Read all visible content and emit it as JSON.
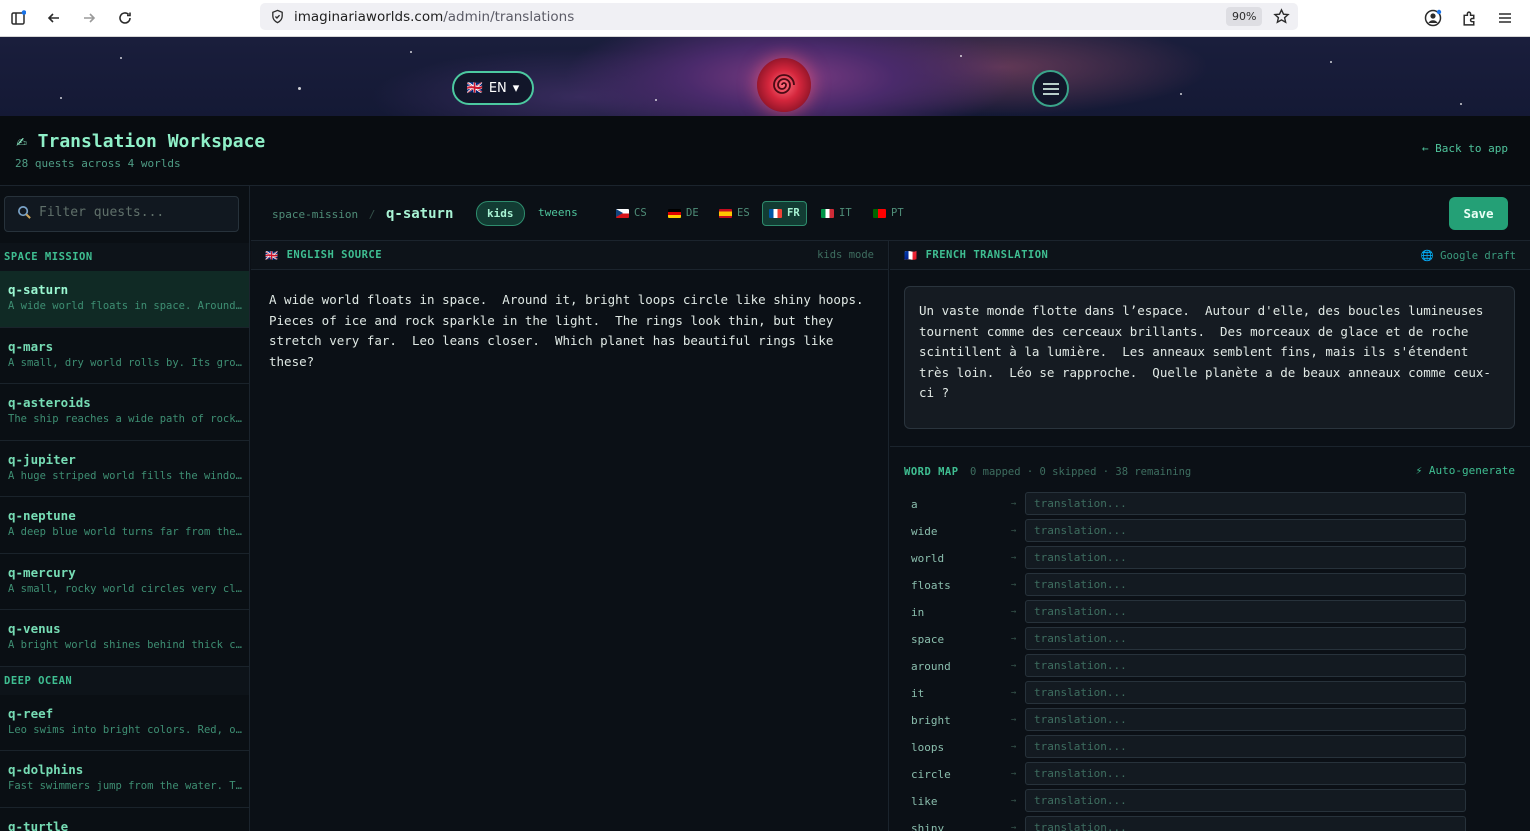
{
  "browser": {
    "url_host": "imaginariaworlds.com",
    "url_path": "/admin/translations",
    "zoom": "90%"
  },
  "banner": {
    "lang_flag": "🇬🇧",
    "lang_code": "EN",
    "lang_caret": "▾"
  },
  "header": {
    "title": "✍ Translation Workspace",
    "subtitle": "28 quests across 4 worlds",
    "back_link": "← Back to app"
  },
  "sidebar": {
    "filter_placeholder": "Filter quests...",
    "sections": [
      {
        "title": "SPACE MISSION",
        "quests": [
          {
            "name": "q-saturn",
            "desc": "A wide world floats in space. Around it, bright loops circle like shiny hoops."
          },
          {
            "name": "q-mars",
            "desc": "A small, dry world rolls by. Its ground is red and dusty."
          },
          {
            "name": "q-asteroids",
            "desc": "The ship reaches a wide path of rocks floating in space."
          },
          {
            "name": "q-jupiter",
            "desc": "A huge striped world fills the window. Storms swirl across it."
          },
          {
            "name": "q-neptune",
            "desc": "A deep blue world turns far from the sun."
          },
          {
            "name": "q-mercury",
            "desc": "A small, rocky world circles very close to the sun."
          },
          {
            "name": "q-venus",
            "desc": "A bright world shines behind thick clouds."
          }
        ]
      },
      {
        "title": "DEEP OCEAN",
        "quests": [
          {
            "name": "q-reef",
            "desc": "Leo swims into bright colors. Red, orange and purple coral grow everywhere."
          },
          {
            "name": "q-dolphins",
            "desc": "Fast swimmers jump from the water. They click and whistle."
          },
          {
            "name": "q-turtle",
            "desc": ""
          }
        ]
      }
    ]
  },
  "topbar": {
    "crumb_world": "space-mission",
    "crumb_sep": "/",
    "crumb_quest": "q-saturn",
    "modes": [
      "kids",
      "tweens"
    ],
    "languages": [
      {
        "code": "CS",
        "flag": "cz"
      },
      {
        "code": "DE",
        "flag": "de"
      },
      {
        "code": "ES",
        "flag": "es"
      },
      {
        "code": "FR",
        "flag": "fr"
      },
      {
        "code": "IT",
        "flag": "it"
      },
      {
        "code": "PT",
        "flag": "pt"
      }
    ],
    "save_label": "Save"
  },
  "source": {
    "flag": "🇬🇧",
    "title": "ENGLISH SOURCE",
    "mode_note": "kids mode",
    "text": "A wide world floats in space.  Around it, bright loops circle like shiny hoops.\nPieces of ice and rock sparkle in the light.  The rings look thin, but they\nstretch very far.  Leo leans closer.  Which planet has beautiful rings like\nthese?"
  },
  "translation": {
    "flag": "🇫🇷",
    "title": "FRENCH TRANSLATION",
    "draft_link": "🌐 Google draft",
    "text": "Un vaste monde flotte dans l’espace.  Autour d'elle, des boucles lumineuses\ntournent comme des cerceaux brillants.  Des morceaux de glace et de roche\nscintillent à la lumière.  Les anneaux semblent fins, mais ils s'étendent\ntrès loin.  Léo se rapproche.  Quelle planète a de beaux anneaux comme ceux-\nci ?"
  },
  "word_map": {
    "title": "WORD MAP",
    "stats": "0 mapped · 0 skipped · 38 remaining",
    "auto_label": "⚡ Auto-generate",
    "arrow": "→",
    "placeholder": "translation...",
    "words": [
      "a",
      "wide",
      "world",
      "floats",
      "in",
      "space",
      "around",
      "it",
      "bright",
      "loops",
      "circle",
      "like",
      "shiny"
    ]
  },
  "colors": {
    "accent": "#3fbf92",
    "save": "#24a076",
    "background": "#0b1016"
  }
}
